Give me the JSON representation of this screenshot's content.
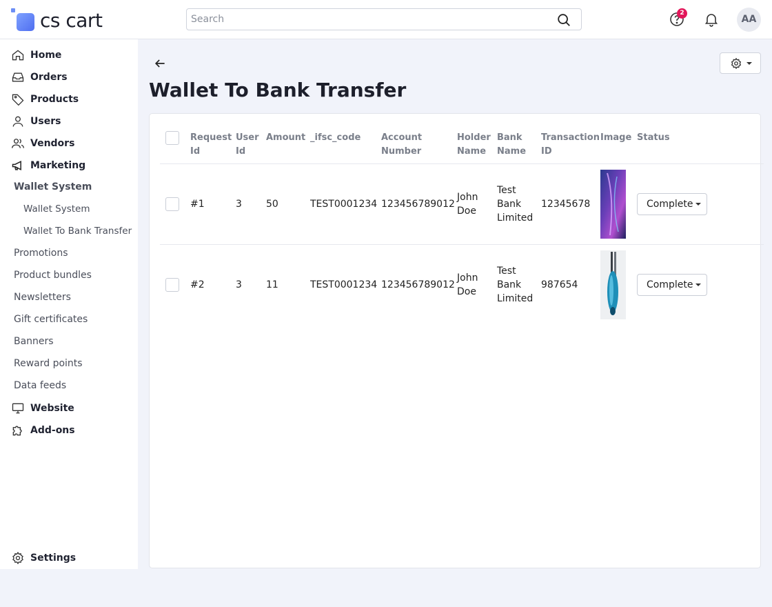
{
  "header": {
    "logo_text": "cs cart",
    "search_placeholder": "Search",
    "help_badge": "2",
    "avatar_initials": "AA"
  },
  "sidebar": {
    "items": [
      {
        "label": "Home",
        "icon": "home-icon"
      },
      {
        "label": "Orders",
        "icon": "inbox-icon"
      },
      {
        "label": "Products",
        "icon": "tag-icon"
      },
      {
        "label": "Users",
        "icon": "user-icon"
      },
      {
        "label": "Vendors",
        "icon": "users-icon"
      },
      {
        "label": "Marketing",
        "icon": "megaphone-icon"
      }
    ],
    "marketing_sub": {
      "wallet_system": "Wallet System",
      "wallet_system_child": "Wallet System",
      "wallet_to_bank": "Wallet To Bank Transfer",
      "promotions": "Promotions",
      "product_bundles": "Product bundles",
      "newsletters": "Newsletters",
      "gift_certificates": "Gift certificates",
      "banners": "Banners",
      "reward_points": "Reward points",
      "data_feeds": "Data feeds"
    },
    "website": "Website",
    "addons": "Add-ons",
    "settings": "Settings"
  },
  "page": {
    "title": "Wallet To Bank Transfer"
  },
  "table": {
    "headers": {
      "request_id": [
        "Request",
        "Id"
      ],
      "user_id": [
        "User",
        "Id"
      ],
      "amount": "Amount",
      "ifsc": "_ifsc_code",
      "account_number": [
        "Account",
        "Number"
      ],
      "holder_name": [
        "Holder",
        "Name"
      ],
      "bank_name": [
        "Bank",
        "Name"
      ],
      "transaction_id": [
        "Transaction",
        "ID"
      ],
      "image": "Image",
      "status": "Status"
    },
    "rows": [
      {
        "request_id": "#1",
        "user_id": "3",
        "amount": "50",
        "ifsc": "TEST0001234",
        "account_number": "123456789012",
        "holder_name": [
          "John",
          "Doe"
        ],
        "bank_name": [
          "Test",
          "Bank",
          "Limited"
        ],
        "transaction_id": "12345678",
        "status": "Complete"
      },
      {
        "request_id": "#2",
        "user_id": "3",
        "amount": "11",
        "ifsc": "TEST0001234",
        "account_number": "123456789012",
        "holder_name": [
          "John",
          "Doe"
        ],
        "bank_name": [
          "Test",
          "Bank",
          "Limited"
        ],
        "transaction_id": "987654",
        "status": "Complete"
      }
    ]
  },
  "colors": {
    "accent": "#4f6ef0",
    "badge": "#e2175a",
    "background": "#f1f3fa"
  }
}
